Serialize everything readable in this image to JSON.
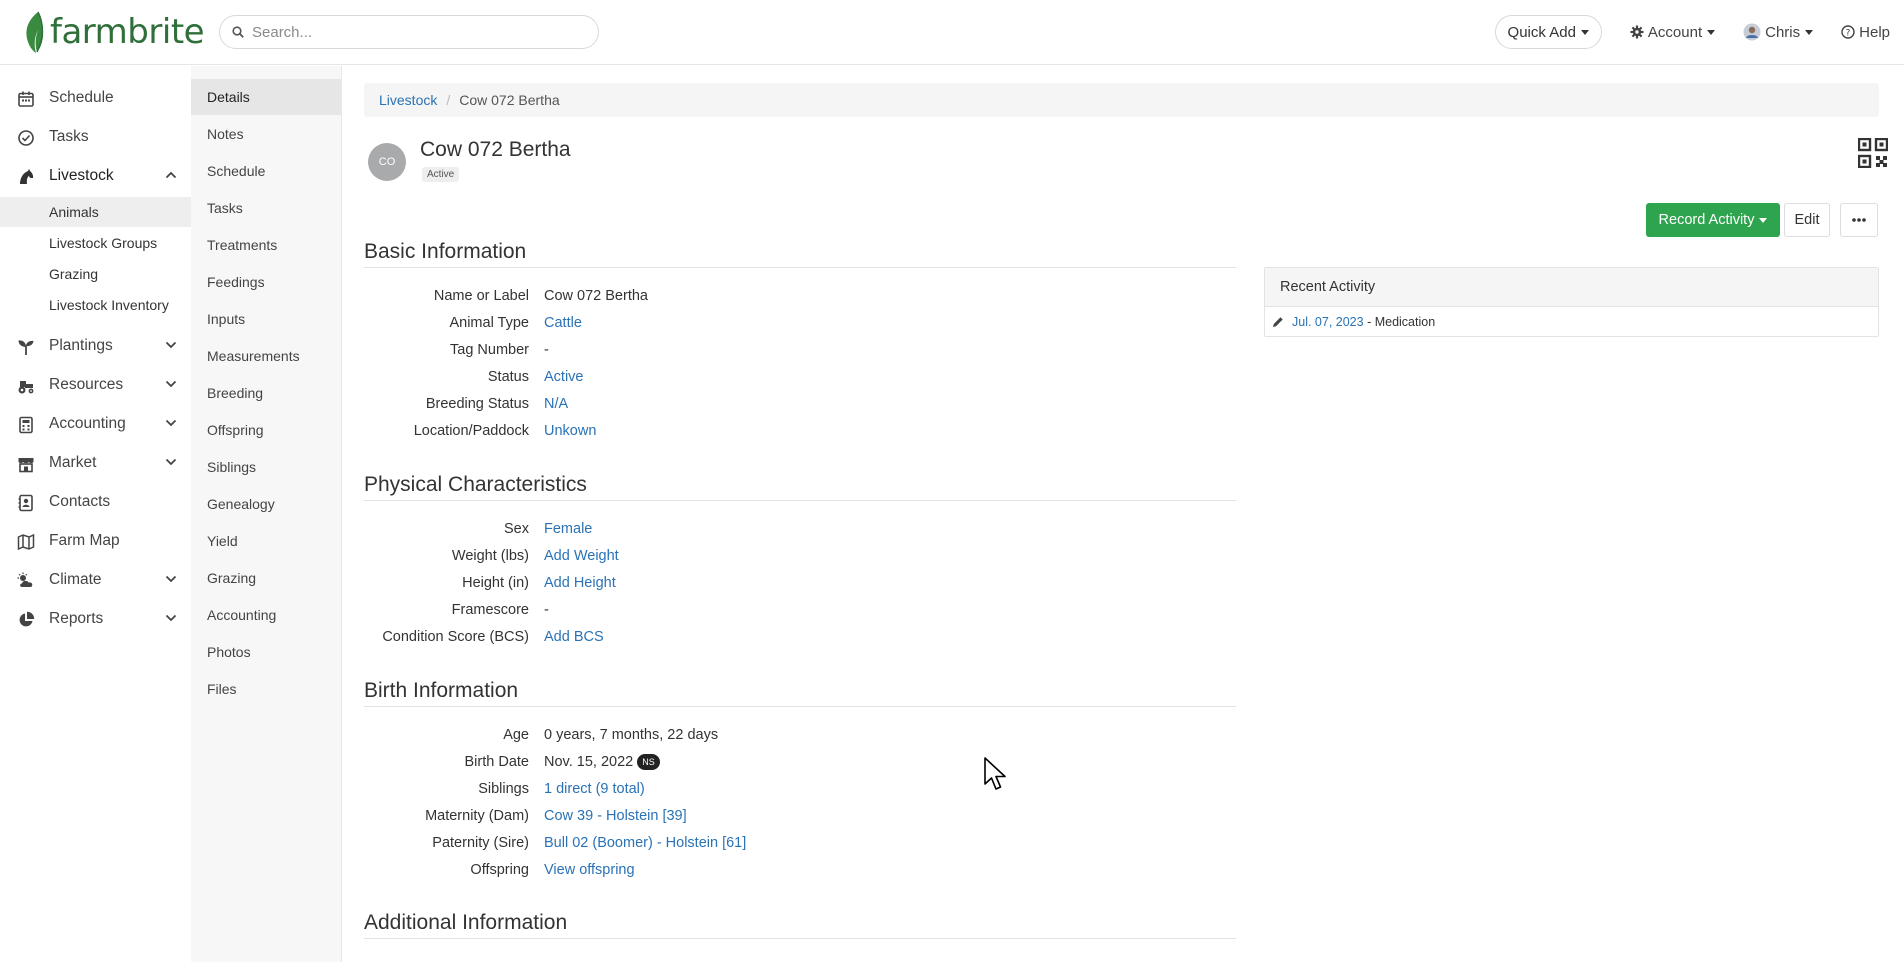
{
  "brand": {
    "name": "farmbrite"
  },
  "search": {
    "placeholder": "Search..."
  },
  "topnav": {
    "quick_add": "Quick Add",
    "account": "Account",
    "user": "Chris",
    "help": "Help"
  },
  "sidebar": {
    "items": [
      {
        "label": "Schedule",
        "icon": "calendar-icon"
      },
      {
        "label": "Tasks",
        "icon": "check-circle-icon"
      },
      {
        "label": "Livestock",
        "icon": "horse-icon",
        "expanded": true
      },
      {
        "label": "Plantings",
        "icon": "sprout-icon"
      },
      {
        "label": "Resources",
        "icon": "tractor-icon"
      },
      {
        "label": "Accounting",
        "icon": "calculator-icon"
      },
      {
        "label": "Market",
        "icon": "store-icon"
      },
      {
        "label": "Contacts",
        "icon": "contact-icon"
      },
      {
        "label": "Farm Map",
        "icon": "map-icon"
      },
      {
        "label": "Climate",
        "icon": "weather-icon"
      },
      {
        "label": "Reports",
        "icon": "pie-chart-icon"
      }
    ],
    "livestock_sub": [
      "Animals",
      "Livestock Groups",
      "Grazing",
      "Livestock Inventory"
    ]
  },
  "subnav": [
    "Details",
    "Notes",
    "Schedule",
    "Tasks",
    "Treatments",
    "Feedings",
    "Inputs",
    "Measurements",
    "Breeding",
    "Offspring",
    "Siblings",
    "Genealogy",
    "Yield",
    "Grazing",
    "Accounting",
    "Photos",
    "Files"
  ],
  "breadcrumb": {
    "parent": "Livestock",
    "current": "Cow 072 Bertha"
  },
  "animal": {
    "initials": "CO",
    "name": "Cow 072 Bertha",
    "status_badge": "Active"
  },
  "actions": {
    "record": "Record Activity",
    "edit": "Edit"
  },
  "sections": {
    "basic": {
      "title": "Basic Information",
      "fields": [
        {
          "label": "Name or Label",
          "value": "Cow 072 Bertha",
          "link": false
        },
        {
          "label": "Animal Type",
          "value": "Cattle",
          "link": true
        },
        {
          "label": "Tag Number",
          "value": "-",
          "link": false
        },
        {
          "label": "Status",
          "value": "Active",
          "link": true
        },
        {
          "label": "Breeding Status",
          "value": "N/A",
          "link": true
        },
        {
          "label": "Location/Paddock",
          "value": "Unkown",
          "link": true
        }
      ]
    },
    "physical": {
      "title": "Physical Characteristics",
      "fields": [
        {
          "label": "Sex",
          "value": "Female",
          "link": true
        },
        {
          "label": "Weight (lbs)",
          "value": "Add Weight",
          "link": true
        },
        {
          "label": "Height (in)",
          "value": "Add Height",
          "link": true
        },
        {
          "label": "Framescore",
          "value": "-",
          "link": false
        },
        {
          "label": "Condition Score (BCS)",
          "value": "Add BCS",
          "link": true
        }
      ]
    },
    "birth": {
      "title": "Birth Information",
      "fields": [
        {
          "label": "Age",
          "value": "0 years, 7 months, 22 days",
          "link": false
        },
        {
          "label": "Birth Date",
          "value": "Nov. 15, 2022",
          "link": false,
          "badge": "NS"
        },
        {
          "label": "Siblings",
          "value": "1 direct (9 total)",
          "link": true
        },
        {
          "label": "Maternity (Dam)",
          "value": "Cow 39 - Holstein [39]",
          "link": true
        },
        {
          "label": "Paternity (Sire)",
          "value": "Bull 02 (Boomer) - Holstein [61]",
          "link": true
        },
        {
          "label": "Offspring",
          "value": "View offspring",
          "link": true
        }
      ]
    },
    "additional": {
      "title": "Additional Information"
    }
  },
  "recent": {
    "title": "Recent Activity",
    "items": [
      {
        "date": "Jul. 07, 2023",
        "text": " - Medication"
      }
    ]
  },
  "colors": {
    "accent": "#2a72b5",
    "record_button": "#2ea44f",
    "brand": "#2f6f3a"
  }
}
